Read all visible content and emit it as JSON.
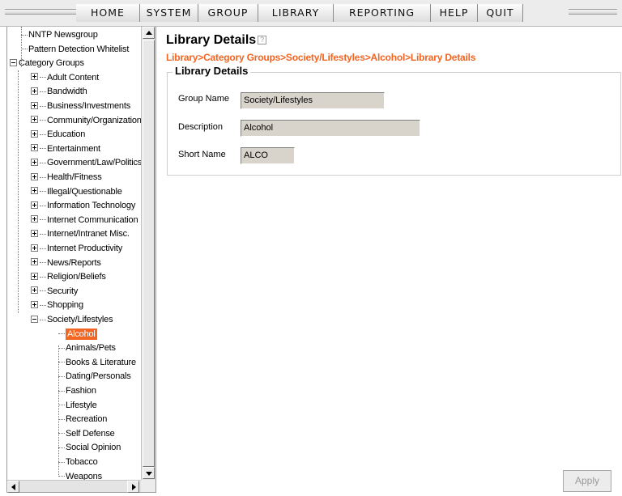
{
  "menu": [
    "HOME",
    "SYSTEM",
    "GROUP",
    "LIBRARY",
    "REPORTING",
    "HELP",
    "QUIT"
  ],
  "tree": {
    "top_items": [
      "NNTP Newsgroup",
      "Pattern Detection Whitelist"
    ],
    "root_label": "Category Groups",
    "groups": [
      "Adult Content",
      "Bandwidth",
      "Business/Investments",
      "Community/Organizations",
      "Education",
      "Entertainment",
      "Government/Law/Politics",
      "Health/Fitness",
      "Illegal/Questionable",
      "Information Technology",
      "Internet Communication",
      "Internet/Intranet Misc.",
      "Internet Productivity",
      "News/Reports",
      "Religion/Beliefs",
      "Security",
      "Shopping"
    ],
    "expanded_group": "Society/Lifestyles",
    "children": [
      "Alcohol",
      "Animals/Pets",
      "Books & Literature",
      "Dating/Personals",
      "Fashion",
      "Lifestyle",
      "Recreation",
      "Self Defense",
      "Social Opinion",
      "Tobacco",
      "Weapons"
    ],
    "selected": "Alcohol"
  },
  "main": {
    "title": "Library Details",
    "breadcrumb": "Library>Category Groups>Society/Lifestyles>Alcohol>Library Details",
    "section_title": "Library Details",
    "fields": [
      {
        "label": "Group Name",
        "value": "Society/Lifestyles"
      },
      {
        "label": "Description",
        "value": "Alcohol"
      },
      {
        "label": "Short Name",
        "value": "ALCO"
      }
    ]
  },
  "buttons": {
    "apply": "Apply"
  },
  "colors": {
    "accent": "#f26522",
    "menubar_bg": "#ececec",
    "field_bg": "#d8d4cc"
  }
}
